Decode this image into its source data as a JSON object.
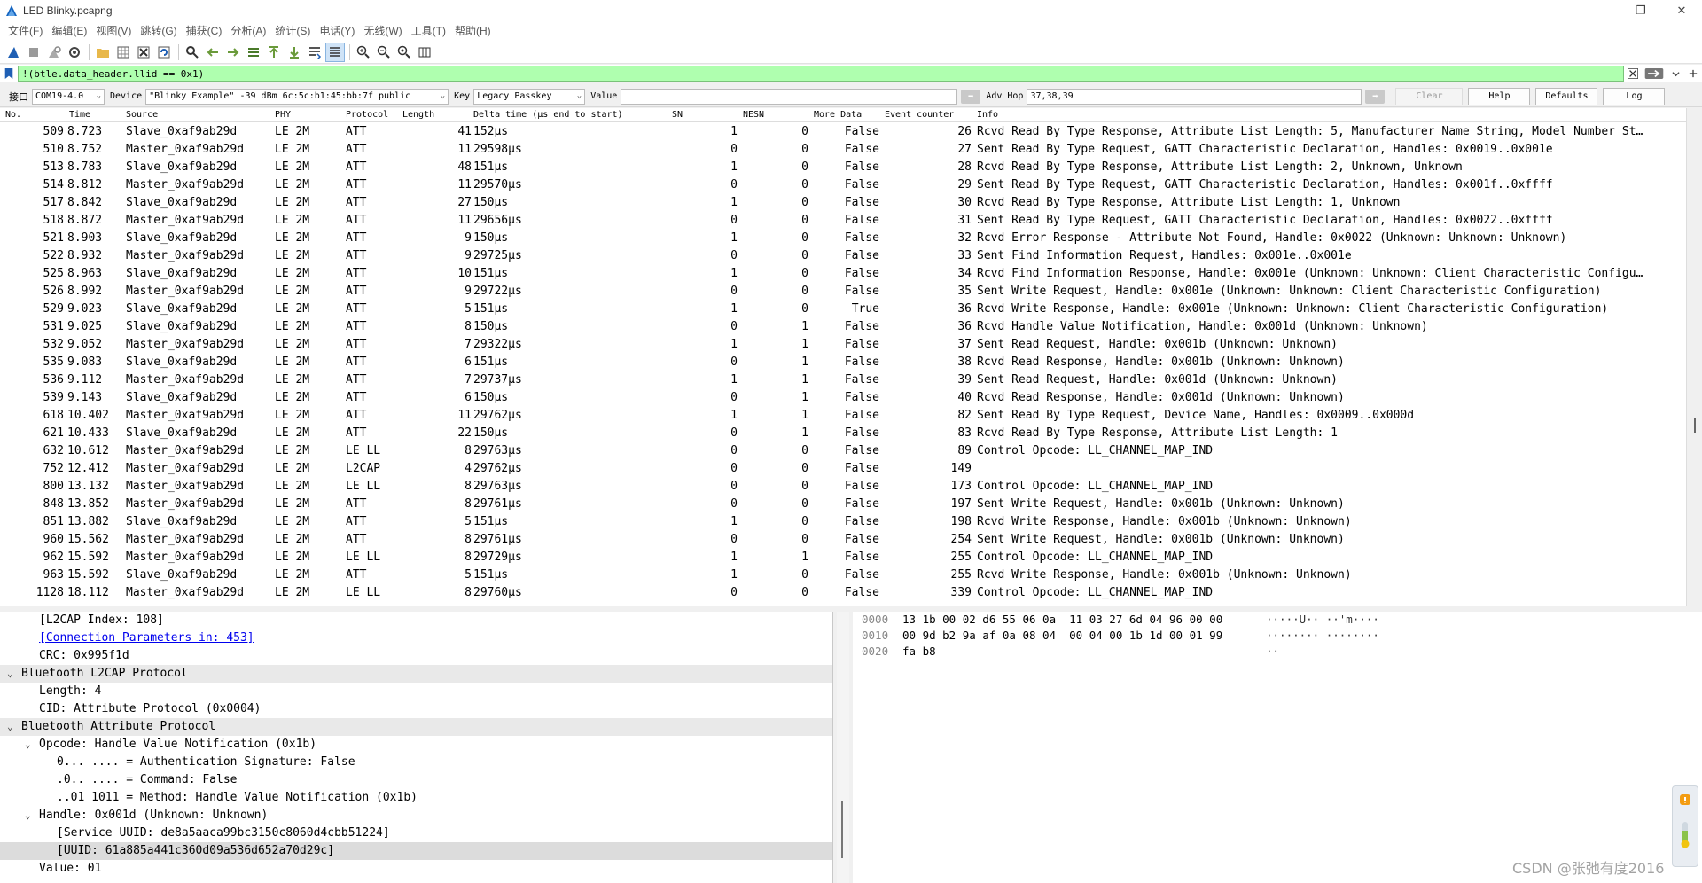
{
  "window": {
    "title": "LED Blinky.pcapng",
    "controls": [
      "—",
      "❐",
      "✕"
    ]
  },
  "menu": [
    "文件(F)",
    "编辑(E)",
    "视图(V)",
    "跳转(G)",
    "捕获(C)",
    "分析(A)",
    "统计(S)",
    "电话(Y)",
    "无线(W)",
    "工具(T)",
    "帮助(H)"
  ],
  "filter": {
    "value": "!(btle.data_header.llid == 0x1)"
  },
  "ble": {
    "interface_label": "接口",
    "interface_value": "COM19-4.0",
    "device_label": "Device",
    "device_value": "\"Blinky Example\"  -39 dBm  6c:5c:b1:45:bb:7f  public",
    "key_label": "Key",
    "key_value": "Legacy Passkey",
    "value_label": "Value",
    "adv_hop_label": "Adv Hop",
    "adv_hop_value": "37,38,39",
    "clear_label": "Clear",
    "help_label": "Help",
    "defaults_label": "Defaults",
    "log_label": "Log"
  },
  "columns": [
    "No.",
    "Time",
    "Source",
    "PHY",
    "Protocol",
    "Length",
    "Delta time (µs end to start)",
    "SN",
    "NESN",
    "More Data",
    "Event counter",
    "Info"
  ],
  "packets": [
    [
      "509",
      "8.723",
      "Slave_0xaf9ab29d",
      "LE 2M",
      "ATT",
      "41",
      "152µs",
      "1",
      "0",
      "False",
      "26",
      "Rcvd Read By Type Response, Attribute List Length: 5, Manufacturer Name String, Model Number St…"
    ],
    [
      "510",
      "8.752",
      "Master_0xaf9ab29d",
      "LE 2M",
      "ATT",
      "11",
      "29598µs",
      "0",
      "0",
      "False",
      "27",
      "Sent Read By Type Request, GATT Characteristic Declaration, Handles: 0x0019..0x001e"
    ],
    [
      "513",
      "8.783",
      "Slave_0xaf9ab29d",
      "LE 2M",
      "ATT",
      "48",
      "151µs",
      "1",
      "0",
      "False",
      "28",
      "Rcvd Read By Type Response, Attribute List Length: 2, Unknown, Unknown"
    ],
    [
      "514",
      "8.812",
      "Master_0xaf9ab29d",
      "LE 2M",
      "ATT",
      "11",
      "29570µs",
      "0",
      "0",
      "False",
      "29",
      "Sent Read By Type Request, GATT Characteristic Declaration, Handles: 0x001f..0xffff"
    ],
    [
      "517",
      "8.842",
      "Slave_0xaf9ab29d",
      "LE 2M",
      "ATT",
      "27",
      "150µs",
      "1",
      "0",
      "False",
      "30",
      "Rcvd Read By Type Response, Attribute List Length: 1, Unknown"
    ],
    [
      "518",
      "8.872",
      "Master_0xaf9ab29d",
      "LE 2M",
      "ATT",
      "11",
      "29656µs",
      "0",
      "0",
      "False",
      "31",
      "Sent Read By Type Request, GATT Characteristic Declaration, Handles: 0x0022..0xffff"
    ],
    [
      "521",
      "8.903",
      "Slave_0xaf9ab29d",
      "LE 2M",
      "ATT",
      "9",
      "150µs",
      "1",
      "0",
      "False",
      "32",
      "Rcvd Error Response - Attribute Not Found, Handle: 0x0022 (Unknown: Unknown: Unknown)"
    ],
    [
      "522",
      "8.932",
      "Master_0xaf9ab29d",
      "LE 2M",
      "ATT",
      "9",
      "29725µs",
      "0",
      "0",
      "False",
      "33",
      "Sent Find Information Request, Handles: 0x001e..0x001e"
    ],
    [
      "525",
      "8.963",
      "Slave_0xaf9ab29d",
      "LE 2M",
      "ATT",
      "10",
      "151µs",
      "1",
      "0",
      "False",
      "34",
      "Rcvd Find Information Response, Handle: 0x001e (Unknown: Unknown: Client Characteristic Configu…"
    ],
    [
      "526",
      "8.992",
      "Master_0xaf9ab29d",
      "LE 2M",
      "ATT",
      "9",
      "29722µs",
      "0",
      "0",
      "False",
      "35",
      "Sent Write Request, Handle: 0x001e (Unknown: Unknown: Client Characteristic Configuration)"
    ],
    [
      "529",
      "9.023",
      "Slave_0xaf9ab29d",
      "LE 2M",
      "ATT",
      "5",
      "151µs",
      "1",
      "0",
      "True",
      "36",
      "Rcvd Write Response, Handle: 0x001e (Unknown: Unknown: Client Characteristic Configuration)"
    ],
    [
      "531",
      "9.025",
      "Slave_0xaf9ab29d",
      "LE 2M",
      "ATT",
      "8",
      "150µs",
      "0",
      "1",
      "False",
      "36",
      "Rcvd Handle Value Notification, Handle: 0x001d (Unknown: Unknown)"
    ],
    [
      "532",
      "9.052",
      "Master_0xaf9ab29d",
      "LE 2M",
      "ATT",
      "7",
      "29322µs",
      "1",
      "1",
      "False",
      "37",
      "Sent Read Request, Handle: 0x001b (Unknown: Unknown)"
    ],
    [
      "535",
      "9.083",
      "Slave_0xaf9ab29d",
      "LE 2M",
      "ATT",
      "6",
      "151µs",
      "0",
      "1",
      "False",
      "38",
      "Rcvd Read Response, Handle: 0x001b (Unknown: Unknown)"
    ],
    [
      "536",
      "9.112",
      "Master_0xaf9ab29d",
      "LE 2M",
      "ATT",
      "7",
      "29737µs",
      "1",
      "1",
      "False",
      "39",
      "Sent Read Request, Handle: 0x001d (Unknown: Unknown)"
    ],
    [
      "539",
      "9.143",
      "Slave_0xaf9ab29d",
      "LE 2M",
      "ATT",
      "6",
      "150µs",
      "0",
      "1",
      "False",
      "40",
      "Rcvd Read Response, Handle: 0x001d (Unknown: Unknown)"
    ],
    [
      "618",
      "10.402",
      "Master_0xaf9ab29d",
      "LE 2M",
      "ATT",
      "11",
      "29762µs",
      "1",
      "1",
      "False",
      "82",
      "Sent Read By Type Request, Device Name, Handles: 0x0009..0x000d"
    ],
    [
      "621",
      "10.433",
      "Slave_0xaf9ab29d",
      "LE 2M",
      "ATT",
      "22",
      "150µs",
      "0",
      "1",
      "False",
      "83",
      "Rcvd Read By Type Response, Attribute List Length: 1"
    ],
    [
      "632",
      "10.612",
      "Master_0xaf9ab29d",
      "LE 2M",
      "LE LL",
      "8",
      "29763µs",
      "0",
      "0",
      "False",
      "89",
      "Control Opcode: LL_CHANNEL_MAP_IND"
    ],
    [
      "752",
      "12.412",
      "Master_0xaf9ab29d",
      "LE 2M",
      "L2CAP",
      "4",
      "29762µs",
      "0",
      "0",
      "False",
      "149",
      ""
    ],
    [
      "800",
      "13.132",
      "Master_0xaf9ab29d",
      "LE 2M",
      "LE LL",
      "8",
      "29763µs",
      "0",
      "0",
      "False",
      "173",
      "Control Opcode: LL_CHANNEL_MAP_IND"
    ],
    [
      "848",
      "13.852",
      "Master_0xaf9ab29d",
      "LE 2M",
      "ATT",
      "8",
      "29761µs",
      "0",
      "0",
      "False",
      "197",
      "Sent Write Request, Handle: 0x001b (Unknown: Unknown)"
    ],
    [
      "851",
      "13.882",
      "Slave_0xaf9ab29d",
      "LE 2M",
      "ATT",
      "5",
      "151µs",
      "1",
      "0",
      "False",
      "198",
      "Rcvd Write Response, Handle: 0x001b (Unknown: Unknown)"
    ],
    [
      "960",
      "15.562",
      "Master_0xaf9ab29d",
      "LE 2M",
      "ATT",
      "8",
      "29761µs",
      "0",
      "0",
      "False",
      "254",
      "Sent Write Request, Handle: 0x001b (Unknown: Unknown)"
    ],
    [
      "962",
      "15.592",
      "Master_0xaf9ab29d",
      "LE 2M",
      "LE LL",
      "8",
      "29729µs",
      "1",
      "1",
      "False",
      "255",
      "Control Opcode: LL_CHANNEL_MAP_IND"
    ],
    [
      "963",
      "15.592",
      "Slave_0xaf9ab29d",
      "LE 2M",
      "ATT",
      "5",
      "151µs",
      "1",
      "0",
      "False",
      "255",
      "Rcvd Write Response, Handle: 0x001b (Unknown: Unknown)"
    ],
    [
      "1128",
      "18.112",
      "Master_0xaf9ab29d",
      "LE 2M",
      "LE LL",
      "8",
      "29760µs",
      "0",
      "0",
      "False",
      "339",
      "Control Opcode: LL_CHANNEL_MAP_IND"
    ]
  ],
  "details": [
    {
      "indent": 2,
      "toggle": "",
      "text": "[L2CAP Index: 108]",
      "style": ""
    },
    {
      "indent": 2,
      "toggle": "",
      "text": "[Connection Parameters in: 453]",
      "style": "link"
    },
    {
      "indent": 2,
      "toggle": "",
      "text": "CRC: 0x995f1d",
      "style": ""
    },
    {
      "indent": 1,
      "toggle": "v",
      "text": "Bluetooth L2CAP Protocol",
      "style": "hl"
    },
    {
      "indent": 2,
      "toggle": "",
      "text": "Length: 4",
      "style": ""
    },
    {
      "indent": 2,
      "toggle": "",
      "text": "CID: Attribute Protocol (0x0004)",
      "style": ""
    },
    {
      "indent": 1,
      "toggle": "v",
      "text": "Bluetooth Attribute Protocol",
      "style": "hl"
    },
    {
      "indent": 2,
      "toggle": "v",
      "text": "Opcode: Handle Value Notification (0x1b)",
      "style": ""
    },
    {
      "indent": 3,
      "toggle": "",
      "text": "0... .... = Authentication Signature: False",
      "style": ""
    },
    {
      "indent": 3,
      "toggle": "",
      "text": ".0.. .... = Command: False",
      "style": ""
    },
    {
      "indent": 3,
      "toggle": "",
      "text": "..01 1011 = Method: Handle Value Notification (0x1b)",
      "style": ""
    },
    {
      "indent": 2,
      "toggle": "v",
      "text": "Handle: 0x001d (Unknown: Unknown)",
      "style": ""
    },
    {
      "indent": 3,
      "toggle": "",
      "text": "[Service UUID: de8a5aaca99bc3150c8060d4cbb51224]",
      "style": ""
    },
    {
      "indent": 3,
      "toggle": "",
      "text": "[UUID: 61a885a441c360d09a536d652a70d29c]",
      "style": "sel"
    },
    {
      "indent": 2,
      "toggle": "",
      "text": "Value: 01",
      "style": ""
    }
  ],
  "bytes": [
    {
      "offset": "0000",
      "hex": "13 1b 00 02 d6 55 06 0a  11 03 27 6d 04 96 00 00",
      "ascii": "·····U·· ··'m····"
    },
    {
      "offset": "0010",
      "hex": "00 9d b2 9a af 0a 08 04  00 04 00 1b 1d 00 01 99",
      "ascii": "········ ········"
    },
    {
      "offset": "0020",
      "hex": "fa b8",
      "ascii": "··"
    }
  ],
  "watermark": "CSDN @张弛有度2016"
}
